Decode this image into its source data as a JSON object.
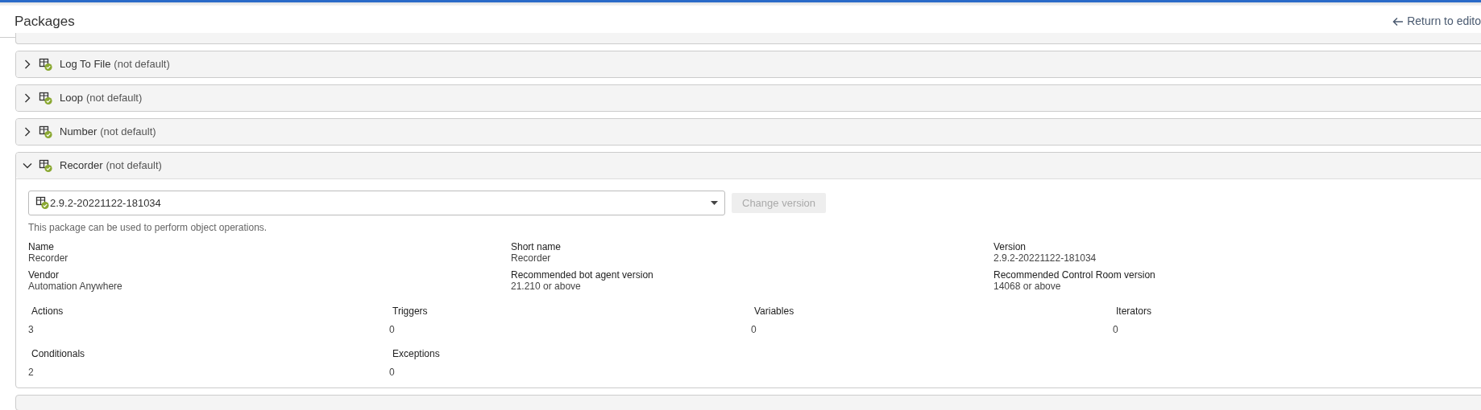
{
  "header": {
    "title": "Packages",
    "return_link": "Return to edito"
  },
  "packages": [
    {
      "kind": "cut_top",
      "expanded": false
    },
    {
      "kind": "package",
      "name": "Log To File",
      "note": "(not default)",
      "expanded": false
    },
    {
      "kind": "package",
      "name": "Loop",
      "note": "(not default)",
      "expanded": false
    },
    {
      "kind": "package",
      "name": "Number",
      "note": "(not default)",
      "expanded": false
    },
    {
      "kind": "package",
      "name": "Recorder",
      "note": "(not default)",
      "expanded": true,
      "details": {
        "version_select": "2.9.2-20221122-181034",
        "change_button": {
          "label": "Change version",
          "disabled": true
        },
        "description": "This package can be used to perform object operations.",
        "fields": [
          {
            "label": "Name",
            "value": "Recorder"
          },
          {
            "label": "Short name",
            "value": "Recorder"
          },
          {
            "label": "Version",
            "value": "2.9.2-20221122-181034"
          },
          {
            "label": "Vendor",
            "value": "Automation Anywhere"
          },
          {
            "label": "Recommended bot agent version",
            "value": "21.210 or above"
          },
          {
            "label": "Recommended Control Room version",
            "value": "14068 or above"
          }
        ],
        "counts": [
          {
            "label": "Actions",
            "value": "3"
          },
          {
            "label": "Triggers",
            "value": "0"
          },
          {
            "label": "Variables",
            "value": "0"
          },
          {
            "label": "Iterators",
            "value": "0"
          },
          {
            "label": "Conditionals",
            "value": "2"
          },
          {
            "label": "Exceptions",
            "value": "0"
          }
        ]
      }
    },
    {
      "kind": "cut_bottom",
      "expanded": false
    }
  ]
}
